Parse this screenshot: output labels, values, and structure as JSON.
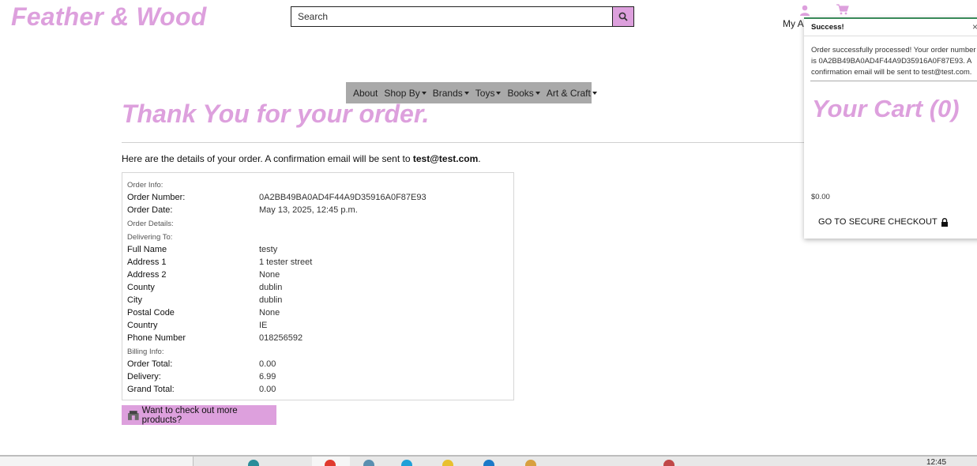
{
  "brand": {
    "name": "Feather & Wood"
  },
  "search": {
    "placeholder": "Search"
  },
  "header": {
    "account_label": "My Ac"
  },
  "nav": {
    "items": [
      {
        "label": "About",
        "dropdown": false
      },
      {
        "label": "Shop By",
        "dropdown": true
      },
      {
        "label": "Brands",
        "dropdown": true
      },
      {
        "label": "Toys",
        "dropdown": true
      },
      {
        "label": "Books",
        "dropdown": true
      },
      {
        "label": "Art & Craft",
        "dropdown": true
      }
    ]
  },
  "main": {
    "title": "Thank You for your order.",
    "intro_text": "Here are the details of your order. A confirmation email will be sent to ",
    "intro_email": "test@test.com",
    "intro_end": ".",
    "sections": {
      "order_info": "Order Info:",
      "order_details": "Order Details:",
      "delivering_to": "Delivering To:",
      "billing_info": "Billing Info:"
    },
    "order_info": [
      {
        "label": "Order Number:",
        "value": "0A2BB49BA0AD4F44A9D35916A0F87E93"
      },
      {
        "label": "Order Date:",
        "value": "May 13, 2025, 12:45 p.m."
      }
    ],
    "delivery": [
      {
        "label": "Full Name",
        "value": "testy"
      },
      {
        "label": "Address 1",
        "value": "1 tester street"
      },
      {
        "label": "Address 2",
        "value": "None"
      },
      {
        "label": "County",
        "value": "dublin"
      },
      {
        "label": "City",
        "value": "dublin"
      },
      {
        "label": "Postal Code",
        "value": "None"
      },
      {
        "label": "Country",
        "value": "IE"
      },
      {
        "label": "Phone Number",
        "value": "018256592"
      }
    ],
    "billing": [
      {
        "label": "Order Total:",
        "value": "0.00"
      },
      {
        "label": "Delivery:",
        "value": "6.99"
      },
      {
        "label": "Grand Total:",
        "value": "0.00"
      }
    ],
    "more_button": "Want to check out more products?"
  },
  "toast": {
    "title": "Success!",
    "close": "×",
    "message": "Order successfully processed! Your order number is 0A2BB49BA0AD4F44A9D35916A0F87E93. A confirmation email will be sent to test@test.com.",
    "cart_title": "Your Cart (0)",
    "cart_total": "$0.00",
    "checkout_label": "GO TO SECURE CHECKOUT"
  },
  "taskbar": {
    "clock": "12:45"
  },
  "colors": {
    "accent": "#dda0dd",
    "nav_bg": "#a9a9a9",
    "toast_border": "#3a8a5a"
  },
  "icons": [
    "search-icon",
    "user-icon",
    "cart-icon",
    "lock-icon",
    "shop-icon",
    "close-icon"
  ]
}
